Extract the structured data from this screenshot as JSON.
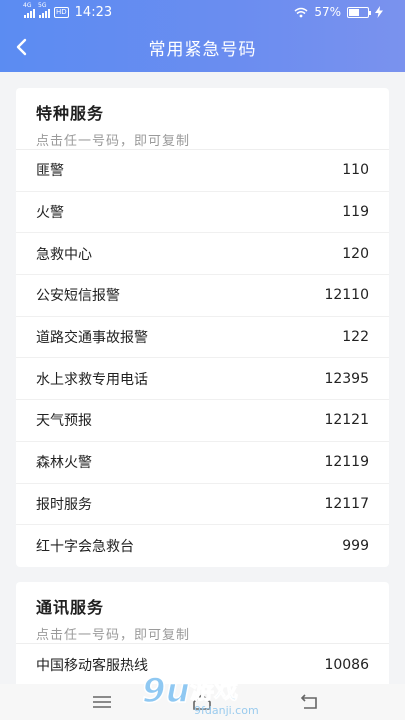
{
  "status_bar": {
    "signal1_tag": "4G",
    "signal2_tag": "5G",
    "hd": "HD",
    "time": "14:23",
    "battery_text": "57%",
    "battery_level": 0.57,
    "icons": [
      "signal-icon",
      "wifi-icon",
      "battery-icon",
      "charging-icon"
    ]
  },
  "header": {
    "title": "常用紧急号码",
    "back_icon": "back-arrow-icon",
    "gradient": [
      "#5b8cf2",
      "#7a92ee"
    ]
  },
  "sections": [
    {
      "title": "特种服务",
      "subtitle": "点击任一号码，即可复制",
      "items": [
        {
          "name": "匪警",
          "number": "110"
        },
        {
          "name": "火警",
          "number": "119"
        },
        {
          "name": "急救中心",
          "number": "120"
        },
        {
          "name": "公安短信报警",
          "number": "12110"
        },
        {
          "name": "道路交通事故报警",
          "number": "122"
        },
        {
          "name": "水上求救专用电话",
          "number": "12395"
        },
        {
          "name": "天气预报",
          "number": "12121"
        },
        {
          "name": "森林火警",
          "number": "12119"
        },
        {
          "name": "报时服务",
          "number": "12117"
        },
        {
          "name": "红十字会急救台",
          "number": "999"
        }
      ]
    },
    {
      "title": "通讯服务",
      "subtitle": "点击任一号码，即可复制",
      "items": [
        {
          "name": "中国移动客服热线",
          "number": "10086"
        }
      ]
    }
  ],
  "bottom_nav": {
    "icons": [
      "menu-icon",
      "home-icon",
      "back-icon"
    ]
  },
  "watermark": {
    "brand": "游戏",
    "mark": "9u",
    "domain": "9fdanji.com"
  }
}
